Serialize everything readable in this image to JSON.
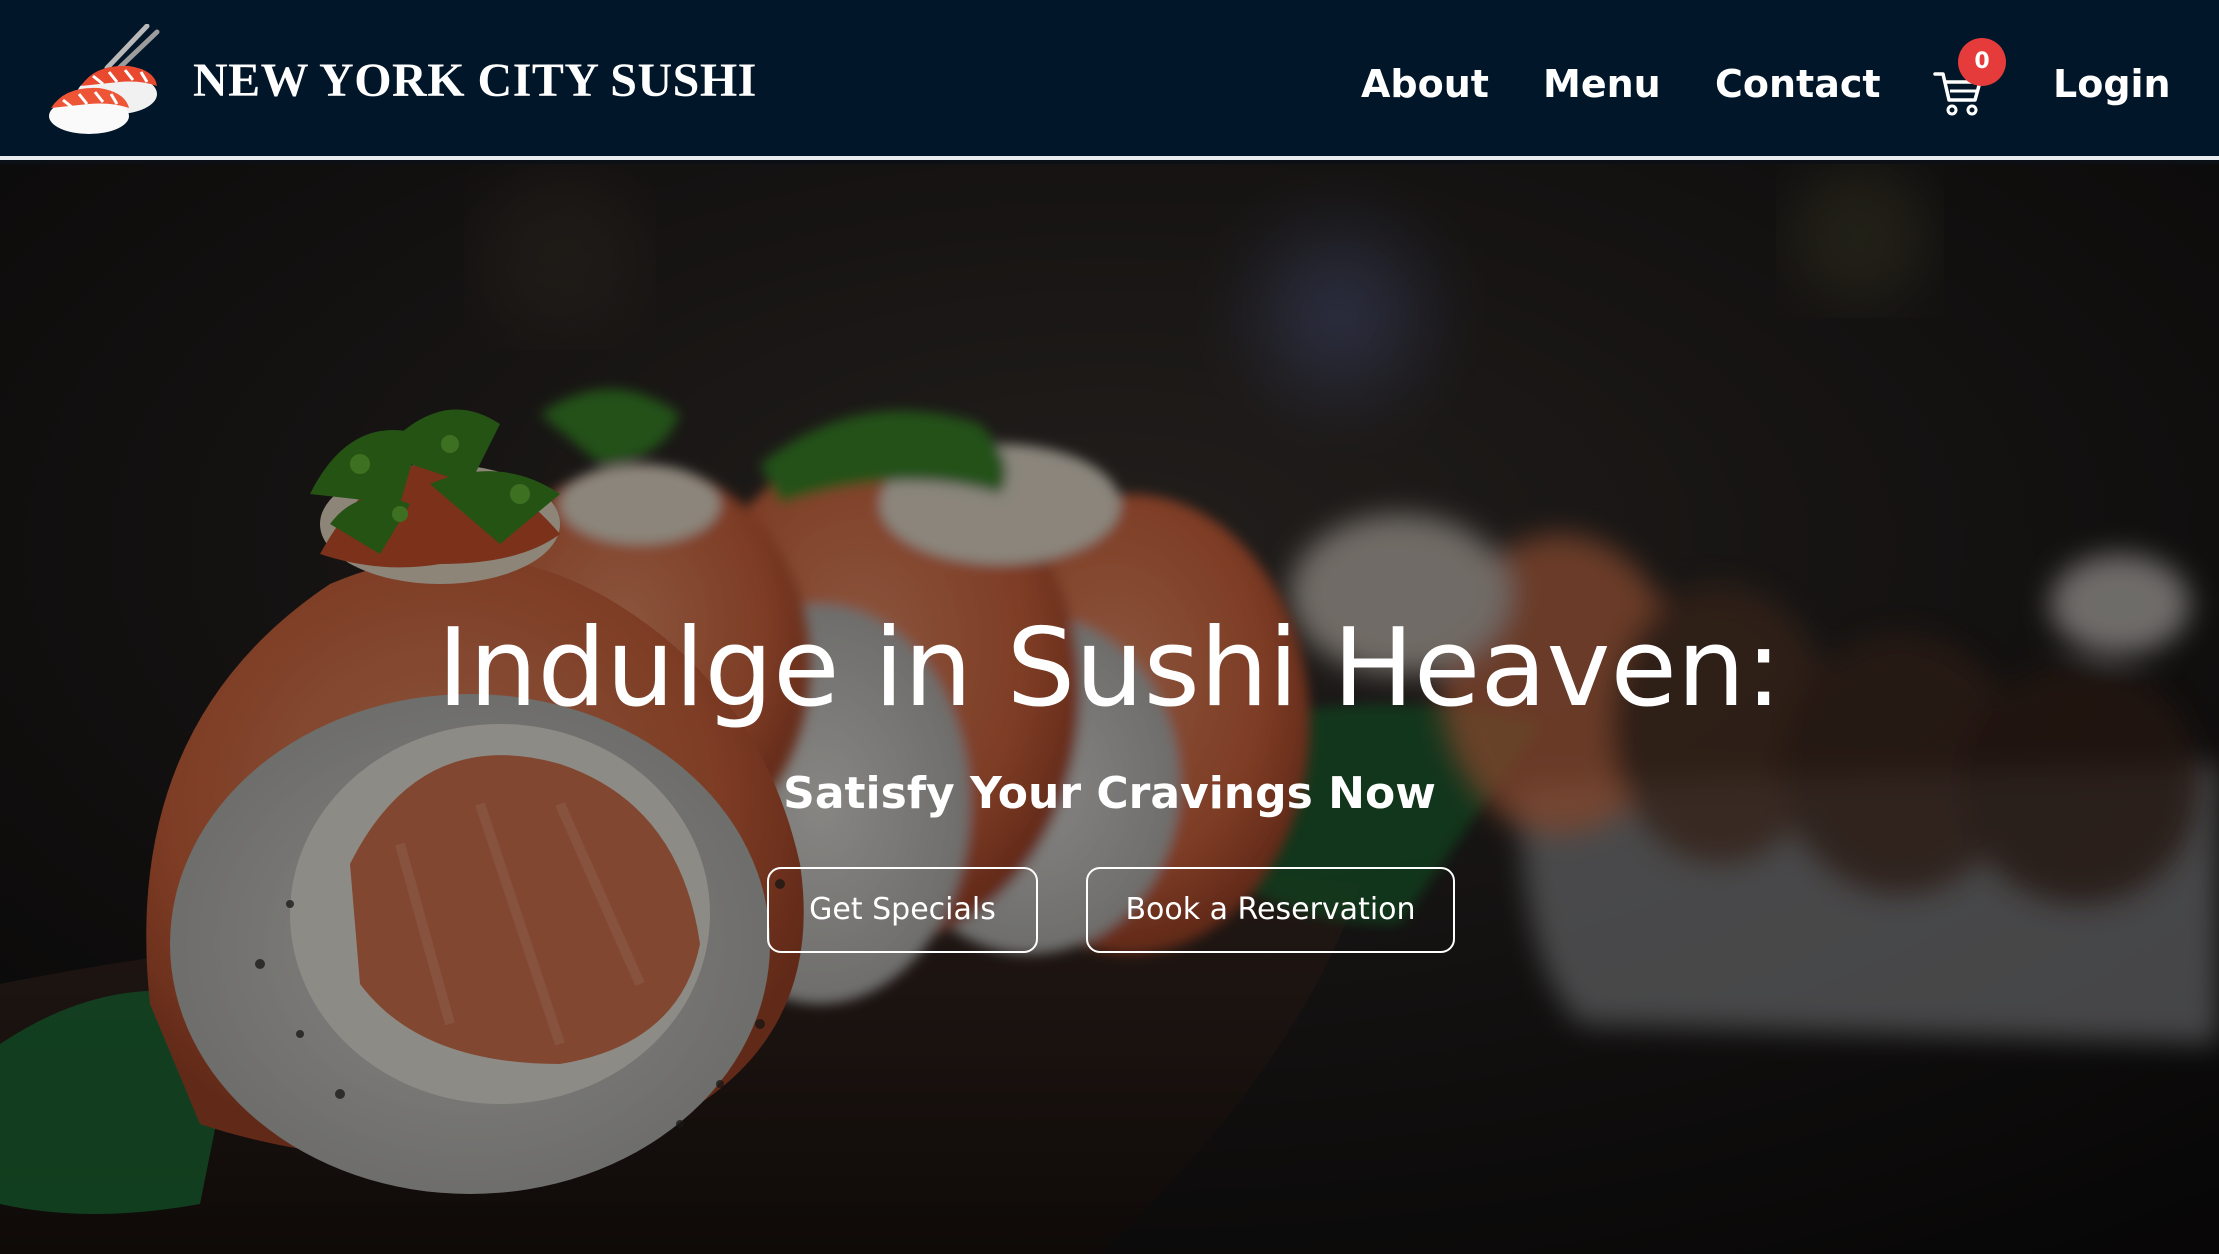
{
  "brand": {
    "name": "NEW YORK CITY SUSHI",
    "logo_icon": "sushi-with-chopsticks-icon"
  },
  "nav": {
    "items": [
      {
        "label": "About"
      },
      {
        "label": "Menu"
      },
      {
        "label": "Contact"
      }
    ],
    "cart": {
      "count": "0",
      "icon": "shopping-cart-icon"
    },
    "login_label": "Login"
  },
  "hero": {
    "title": "Indulge in Sushi Heaven:",
    "subtitle": "Satisfy Your Cravings Now",
    "buttons": [
      {
        "label": "Get Specials"
      },
      {
        "label": "Book a Reservation"
      }
    ]
  },
  "colors": {
    "navbar_bg": "#021629",
    "navbar_border": "#e9ecef",
    "badge": "#e53b3b",
    "text": "#ffffff",
    "salmon": "#e8724a",
    "scallion": "#4f8f2c"
  }
}
